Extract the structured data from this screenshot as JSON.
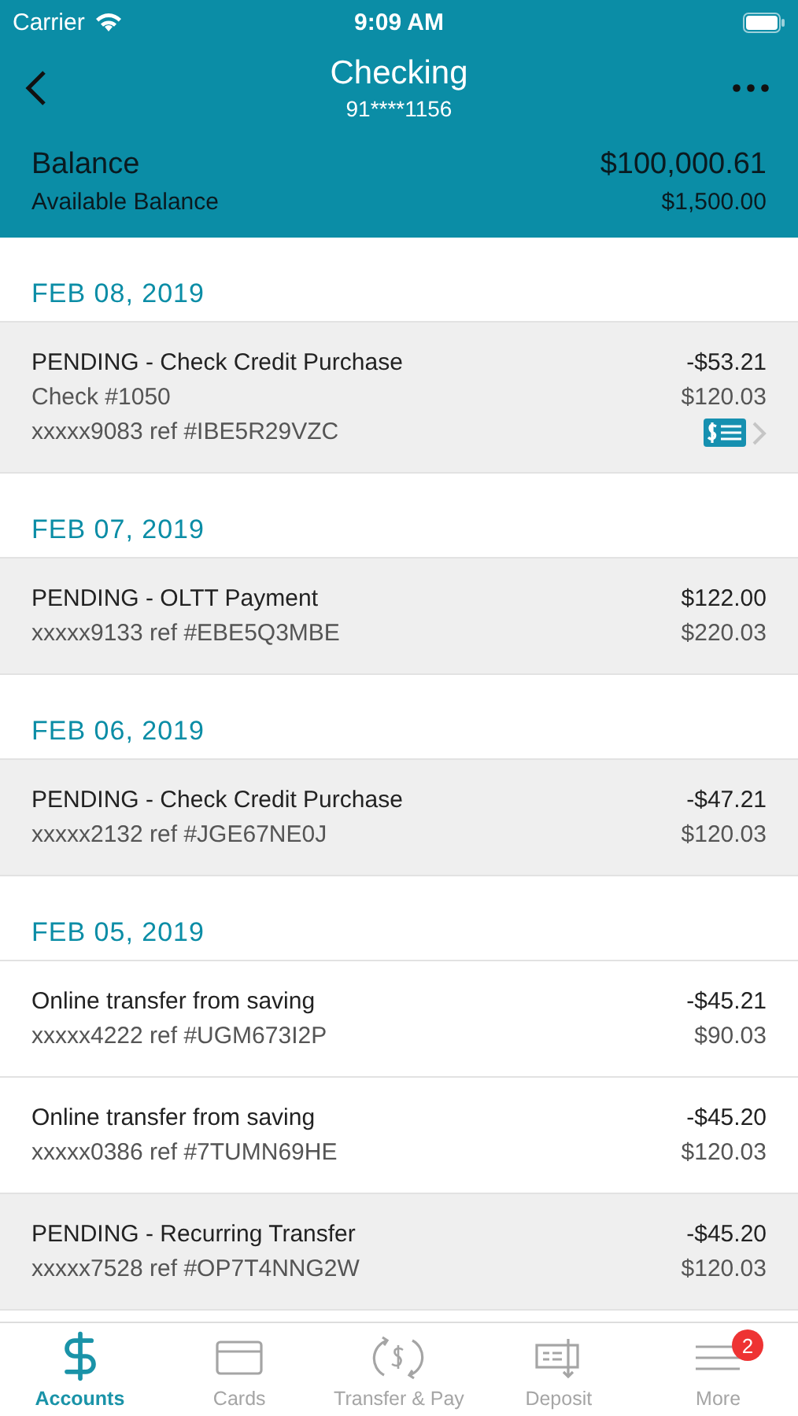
{
  "status_bar": {
    "carrier": "Carrier",
    "time": "9:09 AM"
  },
  "nav": {
    "title": "Checking",
    "subtitle": "91****1156"
  },
  "balance": {
    "label": "Balance",
    "value": "$100,000.61",
    "available_label": "Available Balance",
    "available_value": "$1,500.00"
  },
  "sections": [
    {
      "date": "FEB 08, 2019",
      "transactions": [
        {
          "pending": true,
          "lines": [
            "PENDING - Check Credit Purchase",
            "Check #1050",
            "xxxxx9083 ref #IBE5R29VZC"
          ],
          "amount": "-$53.21",
          "balance": "$120.03",
          "has_check_image": true
        }
      ]
    },
    {
      "date": "FEB 07, 2019",
      "transactions": [
        {
          "pending": true,
          "lines": [
            "PENDING - OLTT Payment",
            "xxxxx9133 ref #EBE5Q3MBE"
          ],
          "amount": "$122.00",
          "balance": "$220.03",
          "has_check_image": false
        }
      ]
    },
    {
      "date": "FEB 06, 2019",
      "transactions": [
        {
          "pending": true,
          "lines": [
            "PENDING - Check Credit Purchase",
            "xxxxx2132 ref #JGE67NE0J"
          ],
          "amount": "-$47.21",
          "balance": "$120.03",
          "has_check_image": false
        }
      ]
    },
    {
      "date": "FEB 05, 2019",
      "transactions": [
        {
          "pending": false,
          "lines": [
            "Online transfer from saving",
            "xxxxx4222 ref #UGM673I2P"
          ],
          "amount": "-$45.21",
          "balance": "$90.03",
          "has_check_image": false
        },
        {
          "pending": false,
          "lines": [
            "Online transfer from saving",
            "xxxxx0386 ref #7TUMN69HE"
          ],
          "amount": "-$45.20",
          "balance": "$120.03",
          "has_check_image": false
        },
        {
          "pending": true,
          "lines": [
            "PENDING - Recurring Transfer",
            "xxxxx7528 ref #OP7T4NNG2W"
          ],
          "amount": "-$45.20",
          "balance": "$120.03",
          "has_check_image": false
        }
      ]
    }
  ],
  "tab_bar": [
    {
      "kind": "accounts",
      "label": "Accounts",
      "selected": true
    },
    {
      "kind": "cards",
      "label": "Cards",
      "selected": false
    },
    {
      "kind": "transfer",
      "label": "Transfer & Pay",
      "selected": false
    },
    {
      "kind": "deposit",
      "label": "Deposit",
      "selected": false
    },
    {
      "kind": "more",
      "label": "More",
      "selected": false,
      "badge": "2"
    }
  ]
}
